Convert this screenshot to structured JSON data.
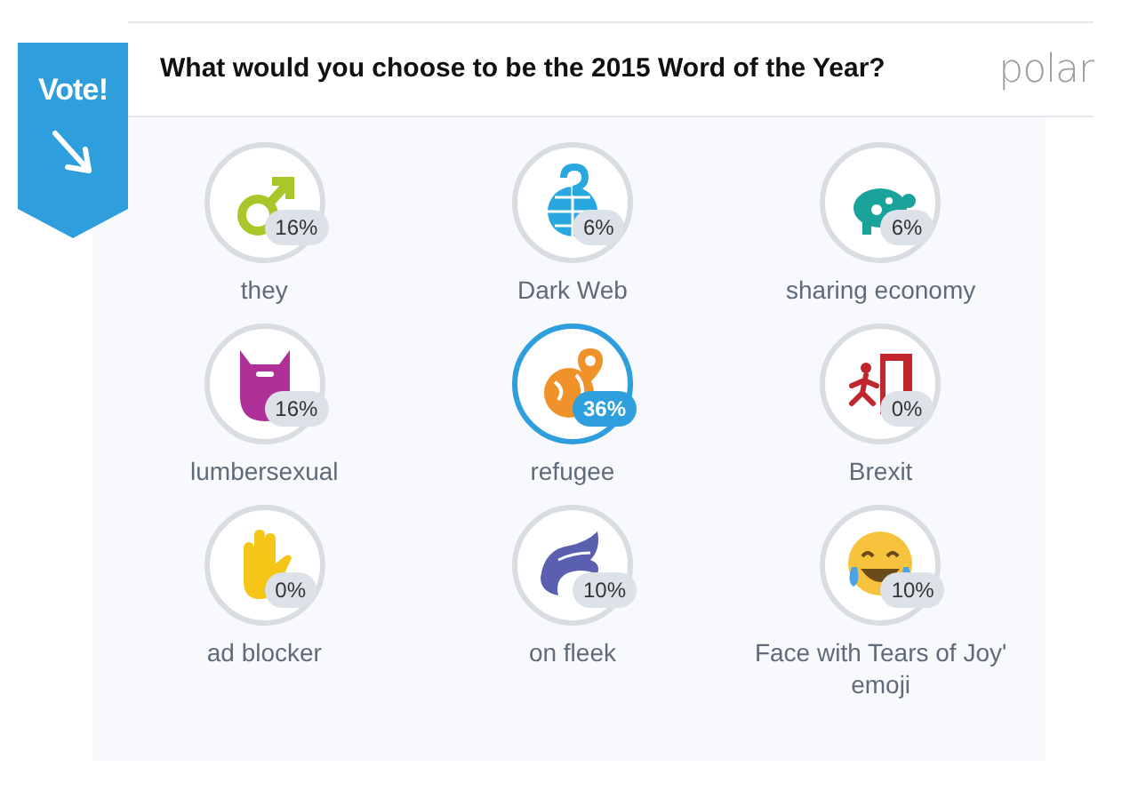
{
  "ribbon": {
    "label": "Vote!"
  },
  "question": "What would you choose to be the 2015 Word of the Year?",
  "brand": "polar",
  "options": [
    {
      "label": "they",
      "percent": "16%",
      "selected": false
    },
    {
      "label": "Dark Web",
      "percent": "6%",
      "selected": false
    },
    {
      "label": "sharing economy",
      "percent": "6%",
      "selected": false
    },
    {
      "label": "lumbersexual",
      "percent": "16%",
      "selected": false
    },
    {
      "label": "refugee",
      "percent": "36%",
      "selected": true
    },
    {
      "label": "Brexit",
      "percent": "0%",
      "selected": false
    },
    {
      "label": "ad blocker",
      "percent": "0%",
      "selected": false
    },
    {
      "label": "on fleek",
      "percent": "10%",
      "selected": false
    },
    {
      "label": "Face with Tears of Joy' emoji",
      "percent": "10%",
      "selected": false
    }
  ]
}
